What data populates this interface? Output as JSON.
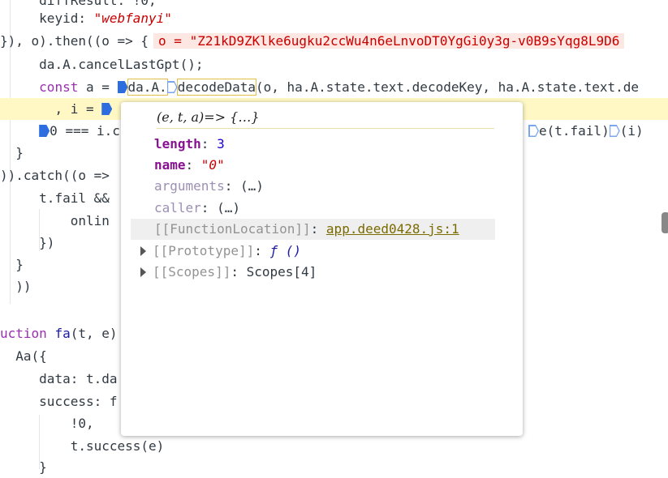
{
  "code": {
    "l0_a": "diffResult: !0,",
    "l1_key": "keyid: ",
    "l1_val": "\"webfanyi\"",
    "l2_pre": "}), o).then((o => {",
    "l2_inline": "o = \"Z21kD9ZKlke6ugku2ccWu4n6eLnvoDT0YgGi0y3g-v0B9sYqg8L9D6",
    "l3": "da.A.cancelLastGpt();",
    "l4_kw": "const",
    "l4_a": " a = ",
    "l4_b": "da.A.",
    "l4_c": "decodeData",
    "l4_d": "(o, ha.A.state.text.decodeKey, ha.A.state.text.de",
    "l5_a": ", i = ",
    "l6_a": "0 === i.c",
    "l6_b": "e(t.fail)",
    "l6_c": "(i)",
    "l7": "}",
    "l8": ")).catch((o =>",
    "l9": "t.fail &&",
    "l10": "onlin",
    "l11": "})",
    "l12": "}",
    "l13": "))",
    "l15_kw": "uction",
    "l15_b": "fa",
    "l15_c": "(t, e)",
    "l16": "Aa({",
    "l17": "data: t.da",
    "l18": "success: f",
    "l19": "!0,",
    "l20": "t.success(e)",
    "l21": "}"
  },
  "popover": {
    "title": "(e, t, a)=> {…}",
    "rows": [
      {
        "key": "length",
        "sep": ": ",
        "val": "3"
      },
      {
        "key": "name",
        "sep": ": ",
        "val": "\"0\""
      },
      {
        "key": "arguments",
        "sep": ": ",
        "val": "(…)"
      },
      {
        "key": "caller",
        "sep": ": ",
        "val": "(…)"
      },
      {
        "key": "[[FunctionLocation]]",
        "sep": ": ",
        "val": "app.deed0428.js:1"
      },
      {
        "key": "[[Prototype]]",
        "sep": ": ",
        "val": "ƒ ()"
      },
      {
        "key": "[[Scopes]]",
        "sep": ": ",
        "val": "Scopes[4]"
      }
    ]
  },
  "colors": {
    "highlight_line": "#fff8c5",
    "keyword": "#9a2fb0",
    "string": "#c80000",
    "breakpoint": "#2e6de0"
  }
}
